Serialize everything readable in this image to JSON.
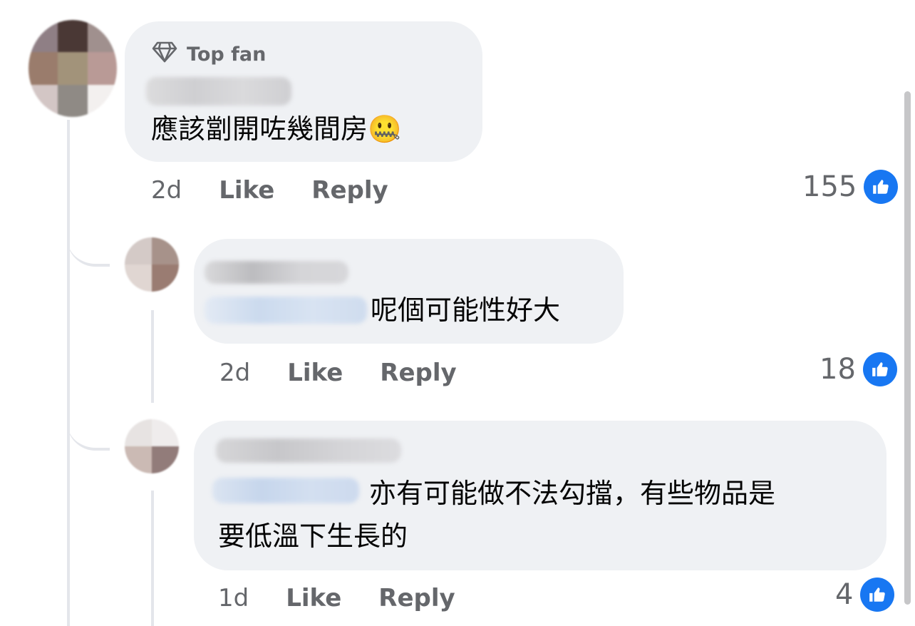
{
  "comments": [
    {
      "badge": "Top fan",
      "text": "應該劏開咗幾間房",
      "emoji": "🤐",
      "time": "2d",
      "like_label": "Like",
      "reply_label": "Reply",
      "reaction_count": "155"
    },
    {
      "text": "呢個可能性好大",
      "time": "2d",
      "like_label": "Like",
      "reply_label": "Reply",
      "reaction_count": "18"
    },
    {
      "text_line1": "亦有可能做不法勾擋，有些物品是",
      "text_line2": "要低溫下生長的",
      "time": "1d",
      "like_label": "Like",
      "reply_label": "Reply",
      "reaction_count": "4"
    }
  ],
  "colors": {
    "bubble": "#eff1f4",
    "secondary_text": "#65676b",
    "like_blue": "#1877f2"
  },
  "icons": [
    "diamond-icon",
    "thumbs-up-icon"
  ]
}
